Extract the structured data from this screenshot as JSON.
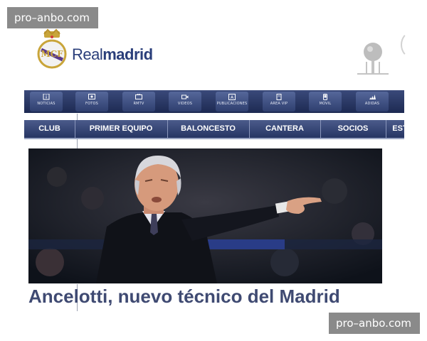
{
  "watermarks": {
    "top": "pro–anbo.com",
    "bottom": "pro–anbo.com"
  },
  "brand": {
    "part1": "Real",
    "part2": "madrid"
  },
  "top_nav": [
    {
      "label": "NOTICIAS",
      "icon": "info-icon"
    },
    {
      "label": "FOTOS",
      "icon": "photo-icon"
    },
    {
      "label": "RMTV",
      "icon": "tv-icon"
    },
    {
      "label": "VIDEOS",
      "icon": "video-camera-icon"
    },
    {
      "label": "PUBLICACIONES",
      "icon": "publication-icon"
    },
    {
      "label": "AREA VIP",
      "icon": "vip-pass-icon"
    },
    {
      "label": "MOVIL",
      "icon": "mobile-phone-icon"
    },
    {
      "label": "ADIDAS",
      "icon": "adidas-logo-icon"
    }
  ],
  "main_nav": [
    {
      "label": "CLUB"
    },
    {
      "label": "PRIMER EQUIPO"
    },
    {
      "label": "BALONCESTO"
    },
    {
      "label": "CANTERA"
    },
    {
      "label": "SOCIOS"
    },
    {
      "label": "EST"
    }
  ],
  "headline": "Ancelotti, nuevo técnico del Madrid",
  "colors": {
    "brand_blue": "#2a3e7a",
    "nav_dark": "#1d2a52",
    "headline": "#3f4a72",
    "watermark_bg": "#8a8a8a"
  }
}
